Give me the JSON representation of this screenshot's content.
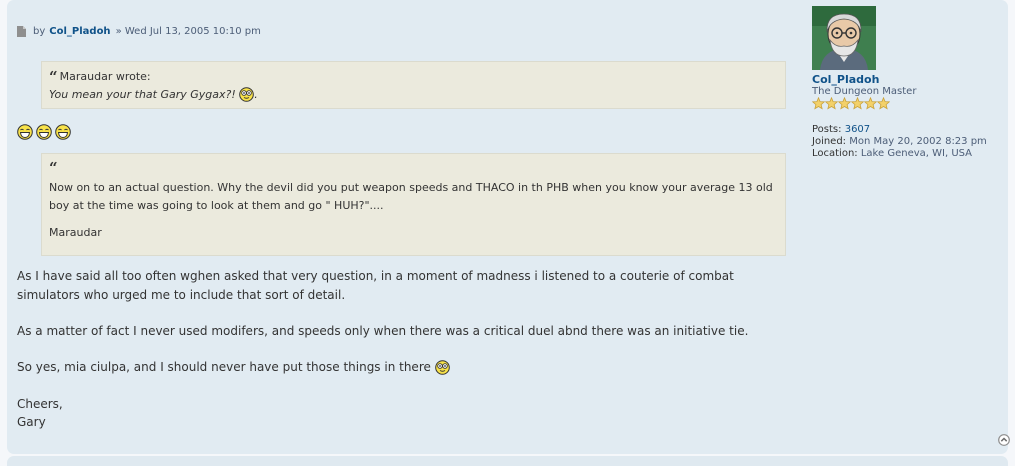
{
  "post": {
    "by_label": "by",
    "author": "Col_Pladoh",
    "date": "» Wed Jul 13, 2005 10:10 pm",
    "quote1": {
      "cite": "Maraudar wrote:",
      "text": "You mean your that Gary Gygax?!",
      "after": "."
    },
    "quote2": {
      "text": "Now on to an actual question. Why the devil did you put weapon speeds and THACO in th PHB when you know your average 13 old boy at the time was going to look at them and go \" HUH?\"....",
      "signature": "Maraudar"
    },
    "paragraphs": [
      "As I have said all too often wghen asked that very question, in a moment of madness i listened to a couterie of combat simulators who urged me to include that sort of detail.",
      "As a matter of fact I never used modifers, and speeds only when there was a critical duel abnd there was an initiative tie.",
      "So yes, mia ciulpa, and I should never have put those things in there",
      "Cheers,",
      "Gary"
    ]
  },
  "profile": {
    "username": "Col_Pladoh",
    "rank": "The Dungeon Master",
    "stars": 6,
    "posts_label": "Posts:",
    "posts": "3607",
    "joined_label": "Joined:",
    "joined": "Mon May 20, 2002 8:23 pm",
    "location_label": "Location:",
    "location": "Lake Geneva, WI, USA"
  },
  "colors": {
    "post_bg": "#e1ebf2",
    "quote_bg": "#ebeadd",
    "link": "#105289",
    "text": "#333333"
  },
  "icons": [
    "file-icon",
    "quote-mark-icon",
    "smiley-icon",
    "star-icon",
    "back-to-top-icon"
  ]
}
